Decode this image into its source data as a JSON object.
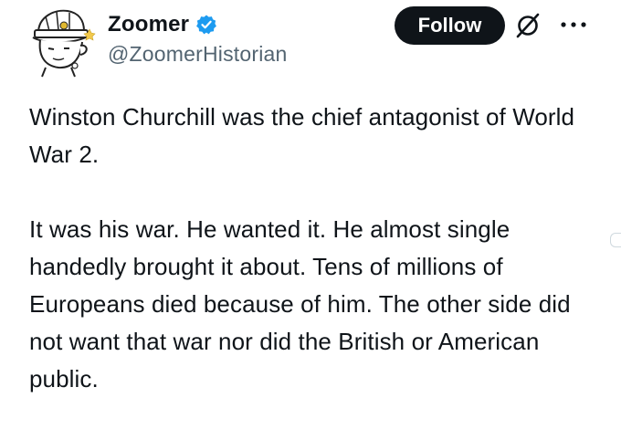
{
  "author": {
    "display_name": "Zoomer",
    "handle": "@ZoomerHistorian",
    "verified": true,
    "avatar_icon": "cartoon-soldier-avatar-icon"
  },
  "actions": {
    "follow_label": "Follow",
    "grok_icon": "grok-icon",
    "more_icon": "more-dots-icon"
  },
  "tweet": {
    "paragraphs": [
      "Winston Churchill was the chief antagonist of World War 2.",
      "It was his war. He wanted it. He almost single handedly brought it about. Tens of millions of Europeans died because of him. The other side did not want that war nor did the British or American public."
    ]
  },
  "colors": {
    "text": "#0f1419",
    "secondary_text": "#536471",
    "verified_blue": "#1d9bf0",
    "button_bg": "#0f1419",
    "button_text": "#ffffff"
  }
}
